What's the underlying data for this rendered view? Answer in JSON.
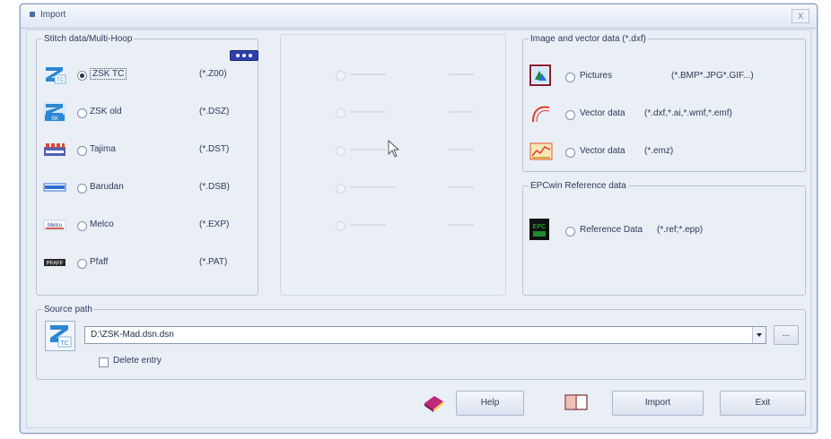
{
  "window": {
    "title": "Import",
    "close_label": "X"
  },
  "stitch_group": {
    "legend": "Stitch data/Multi-Hoop",
    "items": [
      {
        "label": "ZSK TC",
        "ext": "(*.Z00)",
        "selected": true,
        "icon": "zsk-tc-icon"
      },
      {
        "label": "ZSK old",
        "ext": "(*.DSZ)",
        "selected": false,
        "icon": "zsk-old-icon"
      },
      {
        "label": "Tajima",
        "ext": "(*.DST)",
        "selected": false,
        "icon": "tajima-icon"
      },
      {
        "label": "Barudan",
        "ext": "(*.DSB)",
        "selected": false,
        "icon": "barudan-icon"
      },
      {
        "label": "Melco",
        "ext": "(*.EXP)",
        "selected": false,
        "icon": "melco-icon"
      },
      {
        "label": "Pfaff",
        "ext": "(*.PAT)",
        "selected": false,
        "icon": "pfaff-icon"
      }
    ]
  },
  "image_group": {
    "legend": "Image and vector data (*.dxf)",
    "items": [
      {
        "label": "Pictures",
        "ext": "(*.BMP*.JPG*.GIF...)",
        "icon": "picture-icon"
      },
      {
        "label": "Vector data",
        "ext": "(*.dxf,*.ai,*.wmf,*.emf)",
        "icon": "vector-curve-icon"
      },
      {
        "label": "Vector data",
        "ext": "(*.emz)",
        "icon": "vector-chart-icon"
      }
    ]
  },
  "epc_group": {
    "legend": "EPCwin Reference data",
    "item": {
      "label": "Reference Data",
      "ext": "(*.ref;*.epp)",
      "icon": "reference-data-icon"
    }
  },
  "source_group": {
    "legend": "Source path",
    "path_value": "D:\\ZSK-Mad.dsn.dsn",
    "delete_label": "Delete entry",
    "browse_label": "..."
  },
  "buttons": {
    "help": "Help",
    "import": "Import",
    "exit": "Exit"
  }
}
